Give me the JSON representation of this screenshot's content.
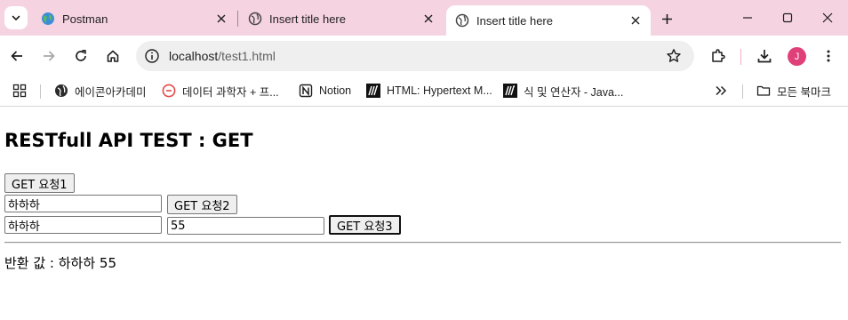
{
  "browser": {
    "tabs": [
      {
        "title": "Postman",
        "favicon": "globe-icon",
        "active": false
      },
      {
        "title": "Insert title here",
        "favicon": "globe-icon",
        "active": false
      },
      {
        "title": "Insert title here",
        "favicon": "globe-icon",
        "active": true
      }
    ],
    "address": {
      "host": "localhost",
      "path": "/test1.html"
    },
    "avatar_letter": "J",
    "colors": {
      "tabstrip": "#f6d3e1",
      "avatar": "#e0407a"
    },
    "bookmarks": [
      {
        "label": "에이콘아카데미",
        "icon": "globe-icon"
      },
      {
        "label": "데이터 과학자 + 프...",
        "icon": "lab-icon"
      },
      {
        "label": "Notion",
        "icon": "notion-icon"
      },
      {
        "label": "HTML: Hypertext M...",
        "icon": "mdn-icon"
      },
      {
        "label": "식 및 연산자 - Java...",
        "icon": "mdn-icon"
      }
    ],
    "all_bookmarks": "모든 북마크"
  },
  "page": {
    "heading": "RESTfull API TEST : GET",
    "button1": "GET 요청1",
    "button2": "GET 요청2",
    "button3": "GET 요청3",
    "row2_input": "하하하",
    "row3_input1": "하하하",
    "row3_input2": "55",
    "result": "반환 값 : 하하하 55"
  }
}
